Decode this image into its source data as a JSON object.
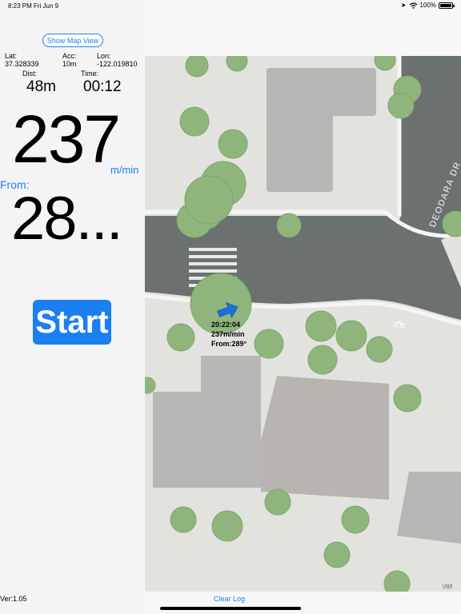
{
  "status_bar": {
    "time": "8:23 PM",
    "date": "Fri Jun 9",
    "battery": "100%"
  },
  "panel": {
    "map_toggle_label": "Show Map View",
    "lat_label": "Lat:",
    "lat_value": "37.328339",
    "acc_label": "Acc:",
    "acc_value": "10m",
    "lon_label": "Lon:",
    "lon_value": "-122.019810",
    "dist_label": "Dist:",
    "dist_value": "48m",
    "time_label": "Time:",
    "time_value": "00:12",
    "speed_value": "237",
    "speed_unit": "m/min",
    "from_label": "From:",
    "heading_value": "28...",
    "start_label": "Start",
    "version": "Ver:1.05"
  },
  "map": {
    "street_name": "DEODARA DR",
    "legal_label": "Legal",
    "marker_info": {
      "timestamp": "20:22:04",
      "speed": "237m/min",
      "heading": "From:289°"
    },
    "clear_log_label": "Clear Log"
  },
  "colors": {
    "accent": "#1c7ff0",
    "road": "#6b7071",
    "ground": "#e3e3df",
    "building": "#b5b5b3",
    "tree": "#8fb57d"
  }
}
